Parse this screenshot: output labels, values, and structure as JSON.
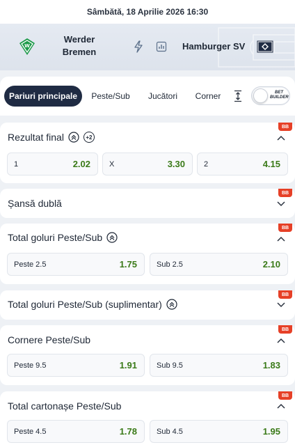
{
  "date_bar": {
    "text": "Sâmbătă, 18 Aprilie 2026 16:30"
  },
  "match": {
    "home": {
      "name": "Werder Bremen",
      "line1": "Werder",
      "line2": "Bremen"
    },
    "away": {
      "name": "Hamburger SV"
    }
  },
  "tabs": [
    {
      "label": "Pariuri principale",
      "active": true
    },
    {
      "label": "Peste/Sub",
      "active": false
    },
    {
      "label": "Jucători",
      "active": false
    },
    {
      "label": "Corner",
      "active": false
    }
  ],
  "bet_builder": {
    "line1": "BET",
    "line2": "BUILDER"
  },
  "colors": {
    "accent_dark": "#1f2b43",
    "odd_green": "#3a7a18",
    "bb_red": "#e64027"
  },
  "markets": [
    {
      "title": "Rezultat final",
      "badge": "BB",
      "expanded": true,
      "extra": "+2",
      "outcomes": [
        {
          "label": "1",
          "value": "2.02"
        },
        {
          "label": "X",
          "value": "3.30"
        },
        {
          "label": "2",
          "value": "4.15"
        }
      ]
    },
    {
      "title": "Șansă dublă",
      "badge": "BB",
      "expanded": false,
      "outcomes": []
    },
    {
      "title": "Total goluri Peste/Sub",
      "badge": "BB",
      "expanded": true,
      "outcomes": [
        {
          "label": "Peste 2.5",
          "value": "1.75"
        },
        {
          "label": "Sub 2.5",
          "value": "2.10"
        }
      ]
    },
    {
      "title": "Total goluri Peste/Sub (suplimentar)",
      "badge": "BB",
      "expanded": false,
      "outcomes": []
    },
    {
      "title": "Cornere Peste/Sub",
      "badge": "BB",
      "expanded": true,
      "outcomes": [
        {
          "label": "Peste 9.5",
          "value": "1.91"
        },
        {
          "label": "Sub 9.5",
          "value": "1.83"
        }
      ]
    },
    {
      "title": "Total cartonașe Peste/Sub",
      "badge": "BB",
      "expanded": true,
      "outcomes": [
        {
          "label": "Peste 4.5",
          "value": "1.78"
        },
        {
          "label": "Sub 4.5",
          "value": "1.95"
        }
      ]
    }
  ]
}
